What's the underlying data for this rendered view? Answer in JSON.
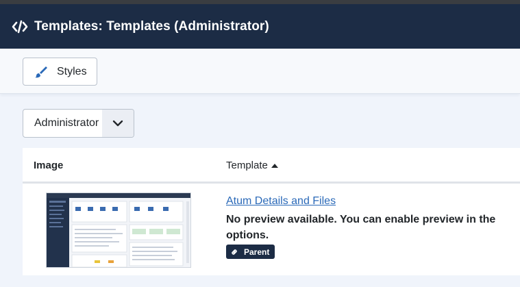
{
  "header": {
    "title": "Templates: Templates (Administrator)",
    "icon": "code-icon",
    "background": "#1c2c45"
  },
  "toolbar": {
    "styles_label": "Styles",
    "styles_icon": "paint-brush-icon"
  },
  "filter": {
    "client_select_value": "Administrator",
    "chevron_icon": "chevron-down-icon"
  },
  "table": {
    "columns": {
      "image": "Image",
      "template": "Template"
    },
    "sort_icon": "sort-asc-icon",
    "rows": [
      {
        "thumbnail": "template-preview-thumbnail",
        "name": "Atum Details and Files",
        "description": "No preview available. You can enable preview in the options.",
        "badge": "Parent",
        "badge_icon": "link-icon"
      }
    ]
  },
  "colors": {
    "accent": "#1c2c45",
    "link": "#2a69b8",
    "page_bg": "#f0f4fb"
  }
}
